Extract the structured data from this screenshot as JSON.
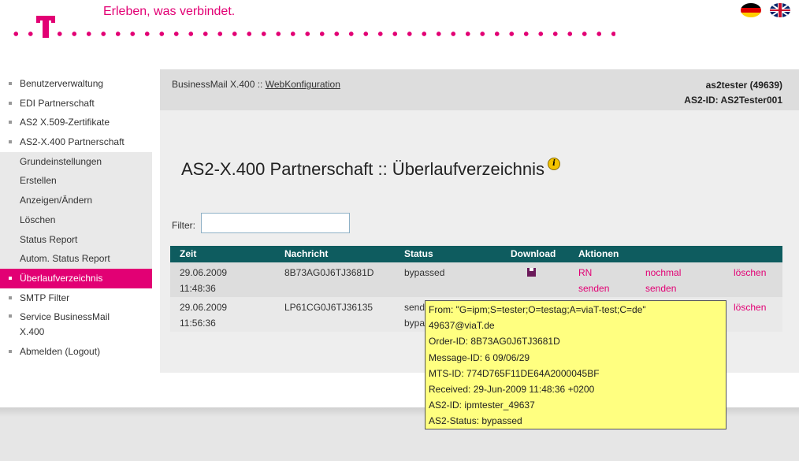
{
  "header": {
    "tagline": "Erleben, was verbindet.",
    "logo": "t-logo",
    "languages": [
      {
        "code": "de",
        "icon": "flag-de-icon"
      },
      {
        "code": "en",
        "icon": "flag-uk-icon"
      }
    ]
  },
  "sidebar": {
    "items": [
      {
        "label": "Benutzerverwaltung"
      },
      {
        "label": "EDI Partnerschaft"
      },
      {
        "label": "AS2 X.509-Zertifikate"
      },
      {
        "label": "AS2-X.400 Partnerschaft"
      }
    ],
    "subitems": [
      {
        "label": "Grundeinstellungen"
      },
      {
        "label": "Erstellen"
      },
      {
        "label": "Anzeigen/Ändern"
      },
      {
        "label": "Löschen"
      },
      {
        "label": "Status Report"
      },
      {
        "label": "Autom. Status Report"
      }
    ],
    "active": {
      "label": "Überlaufverzeichnis"
    },
    "after": [
      {
        "label": "SMTP Filter"
      },
      {
        "label": "Service BusinessMail\nX.400"
      },
      {
        "label": "Abmelden (Logout)"
      }
    ]
  },
  "breadcrumb": {
    "prefix": "BusinessMail X.400 :: ",
    "link": "WebKonfiguration"
  },
  "user": {
    "name": "as2tester (49639)",
    "as2id": "AS2-ID: AS2Tester001"
  },
  "page": {
    "title": "AS2-X.400 Partnerschaft :: Überlaufverzeichnis",
    "info_icon": "info-icon"
  },
  "filter": {
    "label": "Filter:",
    "value": ""
  },
  "table": {
    "headers": [
      "Zeit",
      "Nachricht",
      "Status",
      "Download",
      "Aktionen"
    ],
    "rows": [
      {
        "zeit": "29.06.2009\n11:48:36",
        "nachricht": "8B73AG0J6TJ3681D",
        "status": "bypassed",
        "download_icon": "save-disk-icon",
        "action1": "RN\nsenden",
        "action2": "nochmal\nsenden",
        "action3": "löschen"
      },
      {
        "zeit": "29.06.2009\n11:56:36",
        "nachricht": "LP61CG0J6TJ36135",
        "status": "send\nbypa",
        "action3": "löschen"
      }
    ]
  },
  "tooltip": {
    "lines": [
      "From: \"G=ipm;S=tester;O=testag;A=viaT-test;C=de\"",
      "49637@viaT.de",
      "Order-ID: 8B73AG0J6TJ3681D",
      "Message-ID: 6 09/06/29",
      "MTS-ID: 774D765F11DE64A2000045BF",
      "Received: 29-Jun-2009 11:48:36 +0200",
      "AS2-ID: ipmtester_49637",
      "AS2-Status: bypassed"
    ]
  }
}
